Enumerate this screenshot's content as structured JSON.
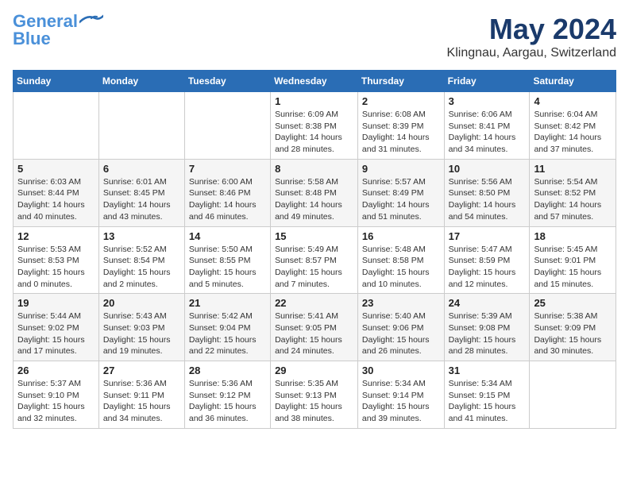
{
  "logo": {
    "line1": "General",
    "line2": "Blue"
  },
  "title": "May 2024",
  "location": "Klingnau, Aargau, Switzerland",
  "weekdays": [
    "Sunday",
    "Monday",
    "Tuesday",
    "Wednesday",
    "Thursday",
    "Friday",
    "Saturday"
  ],
  "weeks": [
    [
      {
        "day": "",
        "info": ""
      },
      {
        "day": "",
        "info": ""
      },
      {
        "day": "",
        "info": ""
      },
      {
        "day": "1",
        "info": "Sunrise: 6:09 AM\nSunset: 8:38 PM\nDaylight: 14 hours\nand 28 minutes."
      },
      {
        "day": "2",
        "info": "Sunrise: 6:08 AM\nSunset: 8:39 PM\nDaylight: 14 hours\nand 31 minutes."
      },
      {
        "day": "3",
        "info": "Sunrise: 6:06 AM\nSunset: 8:41 PM\nDaylight: 14 hours\nand 34 minutes."
      },
      {
        "day": "4",
        "info": "Sunrise: 6:04 AM\nSunset: 8:42 PM\nDaylight: 14 hours\nand 37 minutes."
      }
    ],
    [
      {
        "day": "5",
        "info": "Sunrise: 6:03 AM\nSunset: 8:44 PM\nDaylight: 14 hours\nand 40 minutes."
      },
      {
        "day": "6",
        "info": "Sunrise: 6:01 AM\nSunset: 8:45 PM\nDaylight: 14 hours\nand 43 minutes."
      },
      {
        "day": "7",
        "info": "Sunrise: 6:00 AM\nSunset: 8:46 PM\nDaylight: 14 hours\nand 46 minutes."
      },
      {
        "day": "8",
        "info": "Sunrise: 5:58 AM\nSunset: 8:48 PM\nDaylight: 14 hours\nand 49 minutes."
      },
      {
        "day": "9",
        "info": "Sunrise: 5:57 AM\nSunset: 8:49 PM\nDaylight: 14 hours\nand 51 minutes."
      },
      {
        "day": "10",
        "info": "Sunrise: 5:56 AM\nSunset: 8:50 PM\nDaylight: 14 hours\nand 54 minutes."
      },
      {
        "day": "11",
        "info": "Sunrise: 5:54 AM\nSunset: 8:52 PM\nDaylight: 14 hours\nand 57 minutes."
      }
    ],
    [
      {
        "day": "12",
        "info": "Sunrise: 5:53 AM\nSunset: 8:53 PM\nDaylight: 15 hours\nand 0 minutes."
      },
      {
        "day": "13",
        "info": "Sunrise: 5:52 AM\nSunset: 8:54 PM\nDaylight: 15 hours\nand 2 minutes."
      },
      {
        "day": "14",
        "info": "Sunrise: 5:50 AM\nSunset: 8:55 PM\nDaylight: 15 hours\nand 5 minutes."
      },
      {
        "day": "15",
        "info": "Sunrise: 5:49 AM\nSunset: 8:57 PM\nDaylight: 15 hours\nand 7 minutes."
      },
      {
        "day": "16",
        "info": "Sunrise: 5:48 AM\nSunset: 8:58 PM\nDaylight: 15 hours\nand 10 minutes."
      },
      {
        "day": "17",
        "info": "Sunrise: 5:47 AM\nSunset: 8:59 PM\nDaylight: 15 hours\nand 12 minutes."
      },
      {
        "day": "18",
        "info": "Sunrise: 5:45 AM\nSunset: 9:01 PM\nDaylight: 15 hours\nand 15 minutes."
      }
    ],
    [
      {
        "day": "19",
        "info": "Sunrise: 5:44 AM\nSunset: 9:02 PM\nDaylight: 15 hours\nand 17 minutes."
      },
      {
        "day": "20",
        "info": "Sunrise: 5:43 AM\nSunset: 9:03 PM\nDaylight: 15 hours\nand 19 minutes."
      },
      {
        "day": "21",
        "info": "Sunrise: 5:42 AM\nSunset: 9:04 PM\nDaylight: 15 hours\nand 22 minutes."
      },
      {
        "day": "22",
        "info": "Sunrise: 5:41 AM\nSunset: 9:05 PM\nDaylight: 15 hours\nand 24 minutes."
      },
      {
        "day": "23",
        "info": "Sunrise: 5:40 AM\nSunset: 9:06 PM\nDaylight: 15 hours\nand 26 minutes."
      },
      {
        "day": "24",
        "info": "Sunrise: 5:39 AM\nSunset: 9:08 PM\nDaylight: 15 hours\nand 28 minutes."
      },
      {
        "day": "25",
        "info": "Sunrise: 5:38 AM\nSunset: 9:09 PM\nDaylight: 15 hours\nand 30 minutes."
      }
    ],
    [
      {
        "day": "26",
        "info": "Sunrise: 5:37 AM\nSunset: 9:10 PM\nDaylight: 15 hours\nand 32 minutes."
      },
      {
        "day": "27",
        "info": "Sunrise: 5:36 AM\nSunset: 9:11 PM\nDaylight: 15 hours\nand 34 minutes."
      },
      {
        "day": "28",
        "info": "Sunrise: 5:36 AM\nSunset: 9:12 PM\nDaylight: 15 hours\nand 36 minutes."
      },
      {
        "day": "29",
        "info": "Sunrise: 5:35 AM\nSunset: 9:13 PM\nDaylight: 15 hours\nand 38 minutes."
      },
      {
        "day": "30",
        "info": "Sunrise: 5:34 AM\nSunset: 9:14 PM\nDaylight: 15 hours\nand 39 minutes."
      },
      {
        "day": "31",
        "info": "Sunrise: 5:34 AM\nSunset: 9:15 PM\nDaylight: 15 hours\nand 41 minutes."
      },
      {
        "day": "",
        "info": ""
      }
    ]
  ]
}
